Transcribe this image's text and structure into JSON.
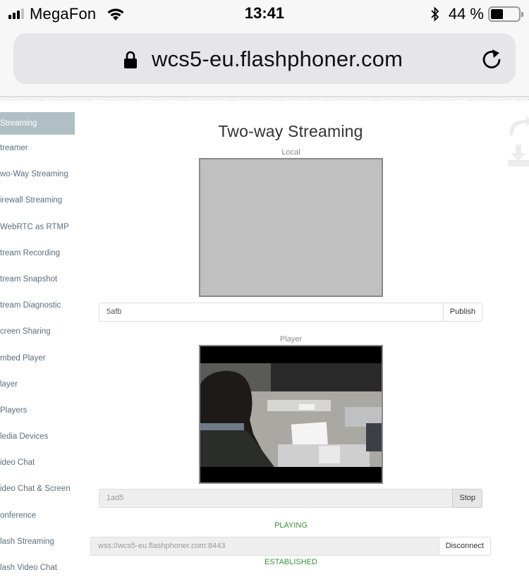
{
  "status_bar": {
    "carrier": "MegaFon",
    "signal_bars_active": 3,
    "signal_bars_total": 4,
    "time": "13:41",
    "battery_percent_label": "44 %",
    "battery_level": 0.44,
    "icons": [
      "signal-icon",
      "wifi-icon",
      "bluetooth-icon",
      "battery-icon"
    ]
  },
  "browser": {
    "url": "wcs5-eu.flashphoner.com",
    "icons": [
      "lock-icon",
      "reload-icon"
    ]
  },
  "sidebar": {
    "items": [
      {
        "label": "Streaming",
        "active": true
      },
      {
        "label": "treamer"
      },
      {
        "label": "wo-Way Streaming"
      },
      {
        "label": "irewall Streaming"
      },
      {
        "label": "WebRTC as RTMP"
      },
      {
        "label": "tream Recording"
      },
      {
        "label": "tream Snapshot"
      },
      {
        "label": "tream Diagnostic"
      },
      {
        "label": "creen Sharing"
      },
      {
        "label": "mbed Player"
      },
      {
        "label": "layer"
      },
      {
        "label": " Players"
      },
      {
        "label": "ledia Devices"
      },
      {
        "label": "ideo Chat"
      },
      {
        "label": "ideo Chat & Screen"
      },
      {
        "label": "onference"
      },
      {
        "label": "lash Streaming"
      },
      {
        "label": "lash Video Chat"
      }
    ]
  },
  "side_icons": [
    "share-icon",
    "download-icon"
  ],
  "main": {
    "title": "Two-way Streaming",
    "local": {
      "label": "Local",
      "stream_name": "5afb",
      "button": "Publish"
    },
    "player": {
      "label": "Player",
      "stream_name": "1ad5",
      "button": "Stop",
      "status": "PLAYING"
    },
    "connection": {
      "url": "wss://wcs5-eu.flashphoner.com:8443",
      "button": "Disconnect",
      "status": "ESTABLISHED"
    }
  },
  "colors": {
    "status_green": "#3c8f3c",
    "sidebar_active": "#b0bfc6",
    "sidebar_text": "#5c6e7e"
  }
}
